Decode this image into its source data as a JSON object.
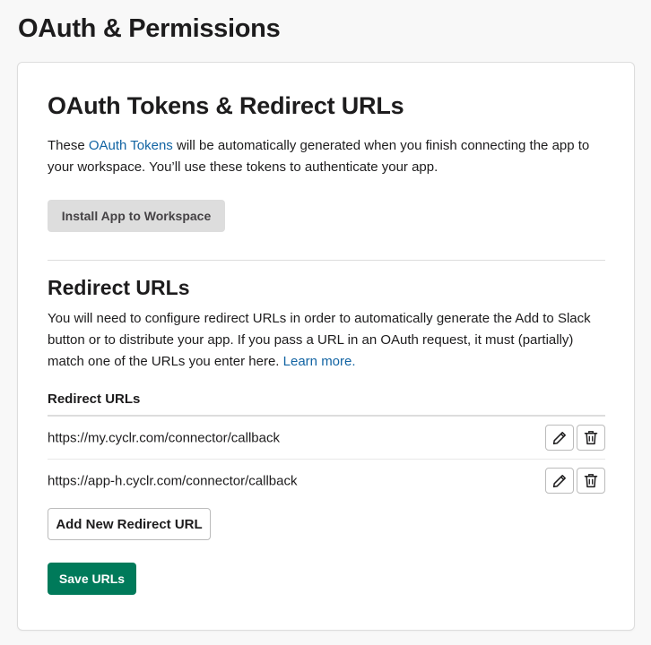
{
  "page": {
    "title": "OAuth & Permissions"
  },
  "oauth_section": {
    "heading": "OAuth Tokens & Redirect URLs",
    "description_before_link": "These ",
    "link_text": "OAuth Tokens",
    "description_after_link": " will be automatically generated when you finish connecting the app to your workspace. You’ll use these tokens to authenticate your app.",
    "install_button_label": "Install App to Workspace"
  },
  "redirect_section": {
    "heading": "Redirect URLs",
    "description": "You will need to configure redirect URLs in order to automatically generate the Add to Slack button or to distribute your app. If you pass a URL in an OAuth request, it must (partially) match one of the URLs you enter here. ",
    "learn_more_link": "Learn more.",
    "table_label": "Redirect URLs",
    "urls": [
      {
        "url": "https://my.cyclr.com/connector/callback",
        "edit_icon": "pencil-icon",
        "delete_icon": "trash-icon"
      },
      {
        "url": "https://app-h.cyclr.com/connector/callback",
        "edit_icon": "pencil-icon",
        "delete_icon": "trash-icon"
      }
    ],
    "add_button_label": "Add New Redirect URL",
    "save_button_label": "Save URLs"
  },
  "colors": {
    "link": "#1264a3",
    "primary_button": "#007a5a",
    "disabled_button": "#dddddd"
  }
}
